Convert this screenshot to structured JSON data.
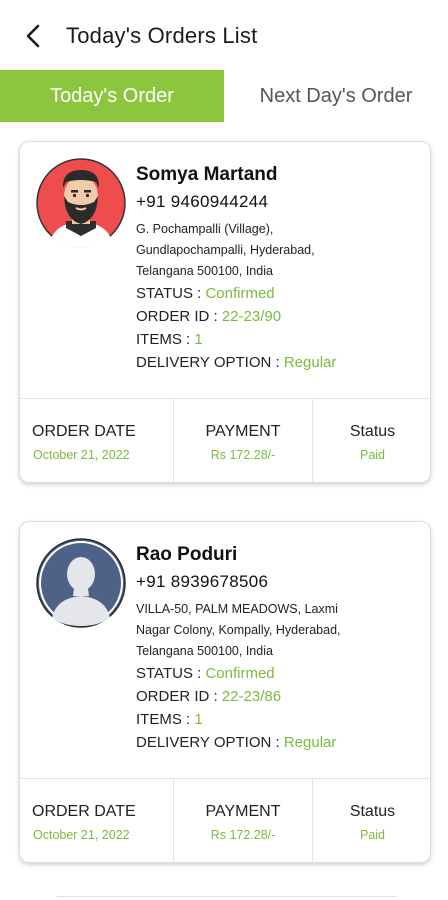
{
  "header": {
    "title": "Today's Orders List",
    "back_icon": "chevron-left-icon"
  },
  "tabs": [
    {
      "label": "Today's Order",
      "active": true
    },
    {
      "label": "Next Day's Order",
      "active": false
    }
  ],
  "colors": {
    "accent": "#8cc63f",
    "value_green": "#7cba3d"
  },
  "orders": [
    {
      "avatar": "bearded-man-avatar",
      "name": "Somya Martand",
      "phone": "+91 9460944244",
      "address_lines": [
        "G. Pochampalli (Village),",
        "Gundlapochampalli, Hyderabad,",
        "Telangana 500100, India"
      ],
      "status_label": "STATUS : ",
      "status_value": "Confirmed",
      "order_id_label": "ORDER ID : ",
      "order_id_value": "22-23/90",
      "items_label": "ITEMS : ",
      "items_value": "1",
      "delivery_label": "DELIVERY OPTION : ",
      "delivery_value": "Regular",
      "order_date_label": "ORDER DATE",
      "order_date_value": "October 21, 2022",
      "payment_label": "PAYMENT",
      "payment_value": "Rs 172.28/-",
      "status_col_label": "Status",
      "status_col_value": "Paid"
    },
    {
      "avatar": "placeholder-person-avatar",
      "name": "Rao Poduri",
      "phone": "+91 8939678506",
      "address_lines": [
        "VILLA-50, PALM MEADOWS, Laxmi",
        "Nagar Colony, Kompally, Hyderabad,",
        "Telangana 500100, India"
      ],
      "status_label": "STATUS : ",
      "status_value": "Confirmed",
      "order_id_label": "ORDER ID : ",
      "order_id_value": "22-23/86",
      "items_label": "ITEMS : ",
      "items_value": "1",
      "delivery_label": "DELIVERY OPTION : ",
      "delivery_value": "Regular",
      "order_date_label": "ORDER DATE",
      "order_date_value": "October 21, 2022",
      "payment_label": "PAYMENT",
      "payment_value": "Rs 172.28/-",
      "status_col_label": "Status",
      "status_col_value": "Paid"
    }
  ]
}
